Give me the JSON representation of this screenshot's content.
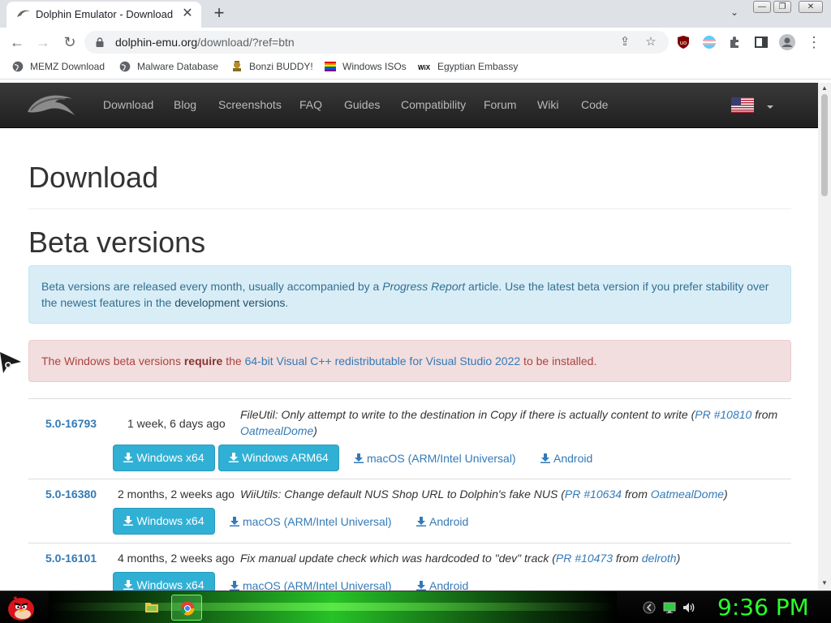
{
  "browser": {
    "tab": {
      "title": "Dolphin Emulator - Download",
      "close": "✕"
    },
    "new_tab": "+",
    "tab_search": "⌄",
    "window_controls": {
      "minimize": "—",
      "restore": "❐",
      "close": "✕"
    },
    "url": {
      "host": "dolphin-emu.org",
      "path": "/download/?ref=btn"
    },
    "nav": {
      "back": "←",
      "forward": "→",
      "reload": "↻",
      "share": "⇪",
      "star": "☆",
      "menu": "⋮"
    }
  },
  "bookmarks": [
    {
      "label": "MEMZ Download",
      "icon": "globe-icon"
    },
    {
      "label": "Malware Database",
      "icon": "globe-icon"
    },
    {
      "label": "Bonzi BUDDY!",
      "icon": "bonzi-icon"
    },
    {
      "label": "Windows ISOs",
      "icon": "rainbow-flag-icon"
    },
    {
      "label": "Egyptian Embassy",
      "icon": "wix-icon",
      "icon_text": "WiX"
    }
  ],
  "site": {
    "nav": [
      "Download",
      "Blog",
      "Screenshots",
      "FAQ",
      "Guides",
      "Compatibility",
      "Forum",
      "Wiki",
      "Code"
    ],
    "heading": "Download",
    "subheading": "Beta versions",
    "info": {
      "t1": "Beta versions are released every month, usually accompanied by a ",
      "em": "Progress Report",
      "t2": " article. Use the latest beta version if you prefer stability over the newest features in the ",
      "link": "development versions",
      "t3": "."
    },
    "warning": {
      "t1": "The Windows beta versions ",
      "strong": "require",
      "t2": " the ",
      "link": "64-bit Visual C++ redistributable for Visual Studio 2022",
      "t3": " to be installed."
    },
    "releases": [
      {
        "version": "5.0-16793",
        "age": "1 week, 6 days ago",
        "desc": "FileUtil: Only attempt to write to the destination in Copy if there is actually content to write (",
        "pr": "PR #10810",
        "from": " from ",
        "author": "OatmealDome",
        "end": ")",
        "buttons": [
          "Windows x64",
          "Windows ARM64"
        ],
        "links": [
          "macOS (ARM/Intel Universal)",
          "Android"
        ]
      },
      {
        "version": "5.0-16380",
        "age": "2 months, 2 weeks ago",
        "desc": "WiiUtils: Change default NUS Shop URL to Dolphin's fake NUS (",
        "pr": "PR #10634",
        "from": " from ",
        "author": "OatmealDome",
        "end": ")",
        "buttons": [
          "Windows x64"
        ],
        "links": [
          "macOS (ARM/Intel Universal)",
          "Android"
        ]
      },
      {
        "version": "5.0-16101",
        "age": "4 months, 2 weeks ago",
        "desc": "Fix manual update check which was hardcoded to \"dev\" track (",
        "pr": "PR #10473",
        "from": " from ",
        "author": "delroth",
        "end": ")",
        "buttons": [
          "Windows x64"
        ],
        "links": [
          "macOS (ARM/Intel Universal)",
          "Android"
        ]
      }
    ]
  },
  "taskbar": {
    "clock": "9:36 PM",
    "apps": [
      "folder-icon",
      "chrome-icon"
    ],
    "tray": [
      "network-icon",
      "monitor-icon",
      "volume-icon"
    ]
  },
  "colors": {
    "link": "#337ab7",
    "info_button": "#31b0d5",
    "clock_green": "#2bff2b"
  }
}
